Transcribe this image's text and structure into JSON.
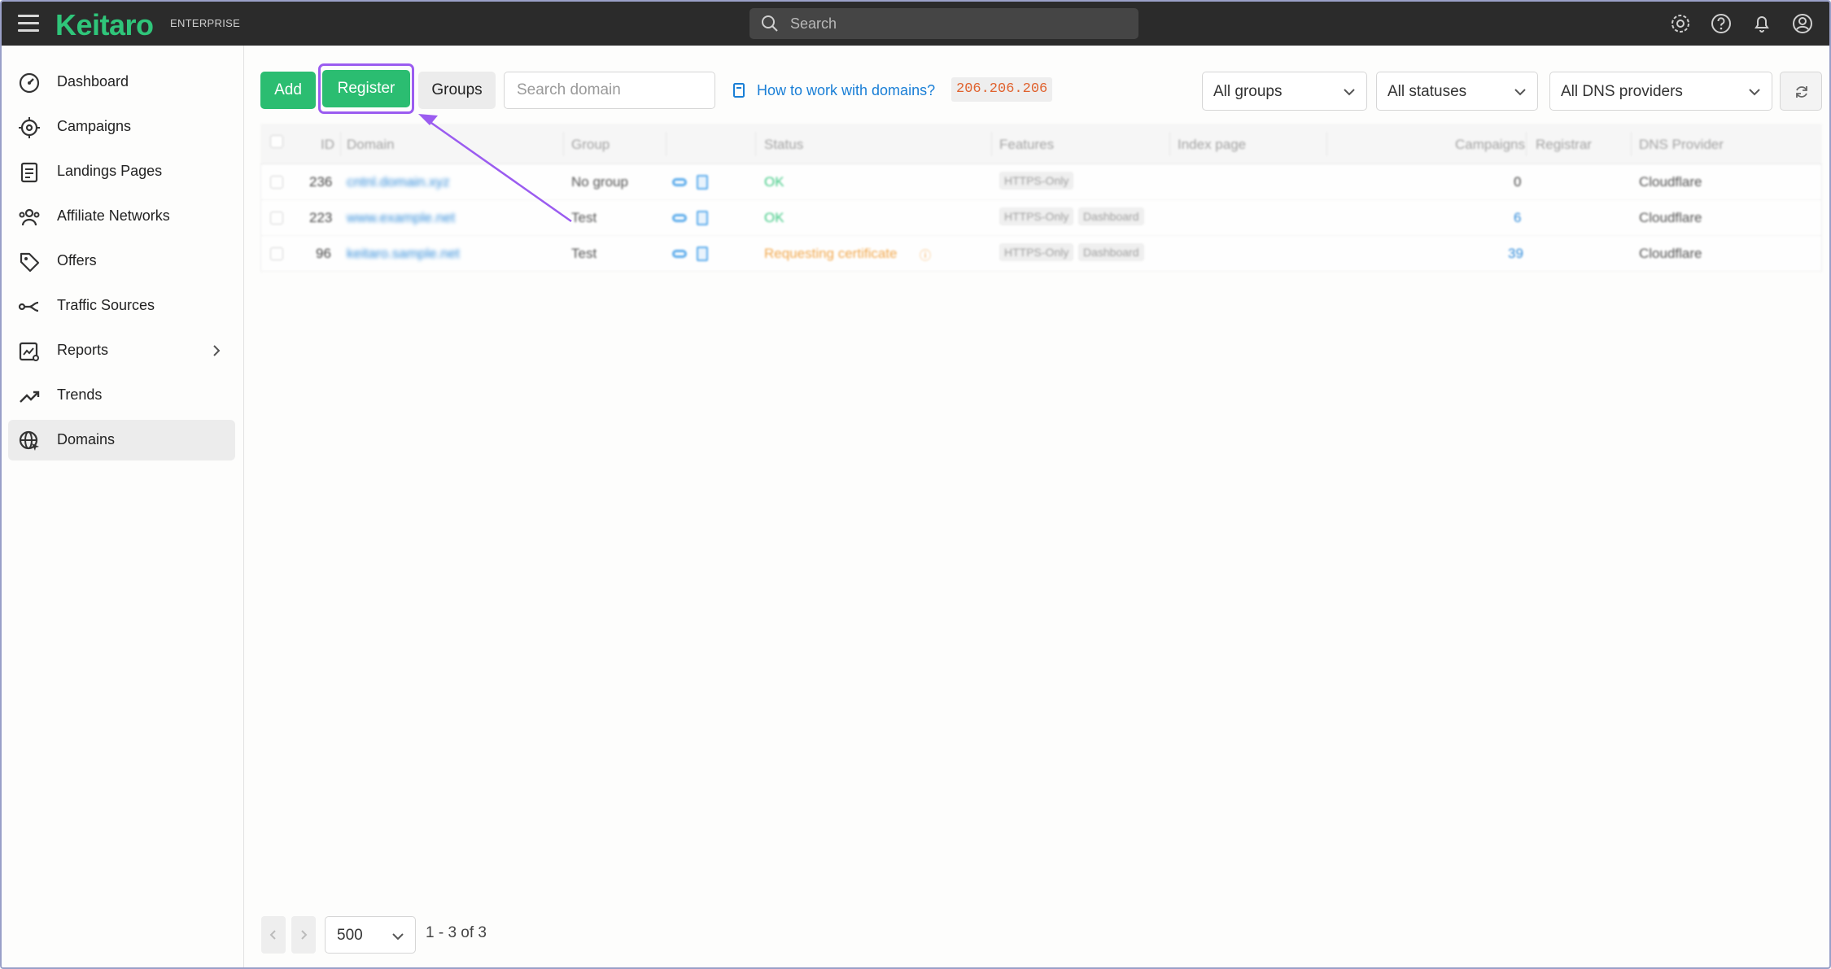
{
  "app": {
    "logo": "Keitaro",
    "edition": "ENTERPRISE"
  },
  "topbar": {
    "search_placeholder": "Search",
    "icons": [
      "gear-icon",
      "help-icon",
      "bell-icon",
      "user-icon"
    ]
  },
  "sidebar": {
    "items": [
      {
        "label": "Dashboard",
        "icon": "speedometer-icon"
      },
      {
        "label": "Campaigns",
        "icon": "target-icon"
      },
      {
        "label": "Landings Pages",
        "icon": "document-icon"
      },
      {
        "label": "Affiliate Networks",
        "icon": "people-icon"
      },
      {
        "label": "Offers",
        "icon": "tag-icon"
      },
      {
        "label": "Traffic Sources",
        "icon": "route-icon"
      },
      {
        "label": "Reports",
        "icon": "chart-icon"
      },
      {
        "label": "Trends",
        "icon": "trend-icon"
      },
      {
        "label": "Domains",
        "icon": "globe-icon",
        "active": true
      }
    ]
  },
  "toolbar": {
    "add_label": "Add",
    "register_label": "Register",
    "groups_label": "Groups",
    "search_placeholder": "Search domain",
    "help_link": "How to work with domains?",
    "ip": "206.206.206",
    "filter_groups": "All groups",
    "filter_statuses": "All statuses",
    "filter_dns": "All DNS providers"
  },
  "table": {
    "columns": {
      "id": "ID",
      "domain": "Domain",
      "group": "Group",
      "status": "Status",
      "features": "Features",
      "index_page": "Index page",
      "campaigns": "Campaigns",
      "registrar": "Registrar",
      "dns_provider": "DNS Provider"
    },
    "rows": [
      {
        "id": "236",
        "domain": "cntnl.domain.xyz",
        "group": "No group",
        "status": "OK",
        "features": [
          "HTTPS-Only"
        ],
        "campaigns": "0",
        "dns": "Cloudflare"
      },
      {
        "id": "223",
        "domain": "www.example.net",
        "group": "Test",
        "status": "OK",
        "features": [
          "HTTPS-Only",
          "Dashboard"
        ],
        "campaigns": "6",
        "dns": "Cloudflare"
      },
      {
        "id": "96",
        "domain": "keitaro.sample.net",
        "group": "Test",
        "status": "Requesting certificate",
        "features": [
          "HTTPS-Only",
          "Dashboard"
        ],
        "campaigns": "39",
        "dns": "Cloudflare"
      }
    ],
    "colors": {
      "ok": "#2fc57a",
      "warning": "#f0a03c",
      "link": "#1a7fd6"
    }
  },
  "pagination": {
    "per_page": "500",
    "info": "1 - 3 of 3"
  },
  "annotation": {
    "highlight_color": "#9b5cf0"
  }
}
